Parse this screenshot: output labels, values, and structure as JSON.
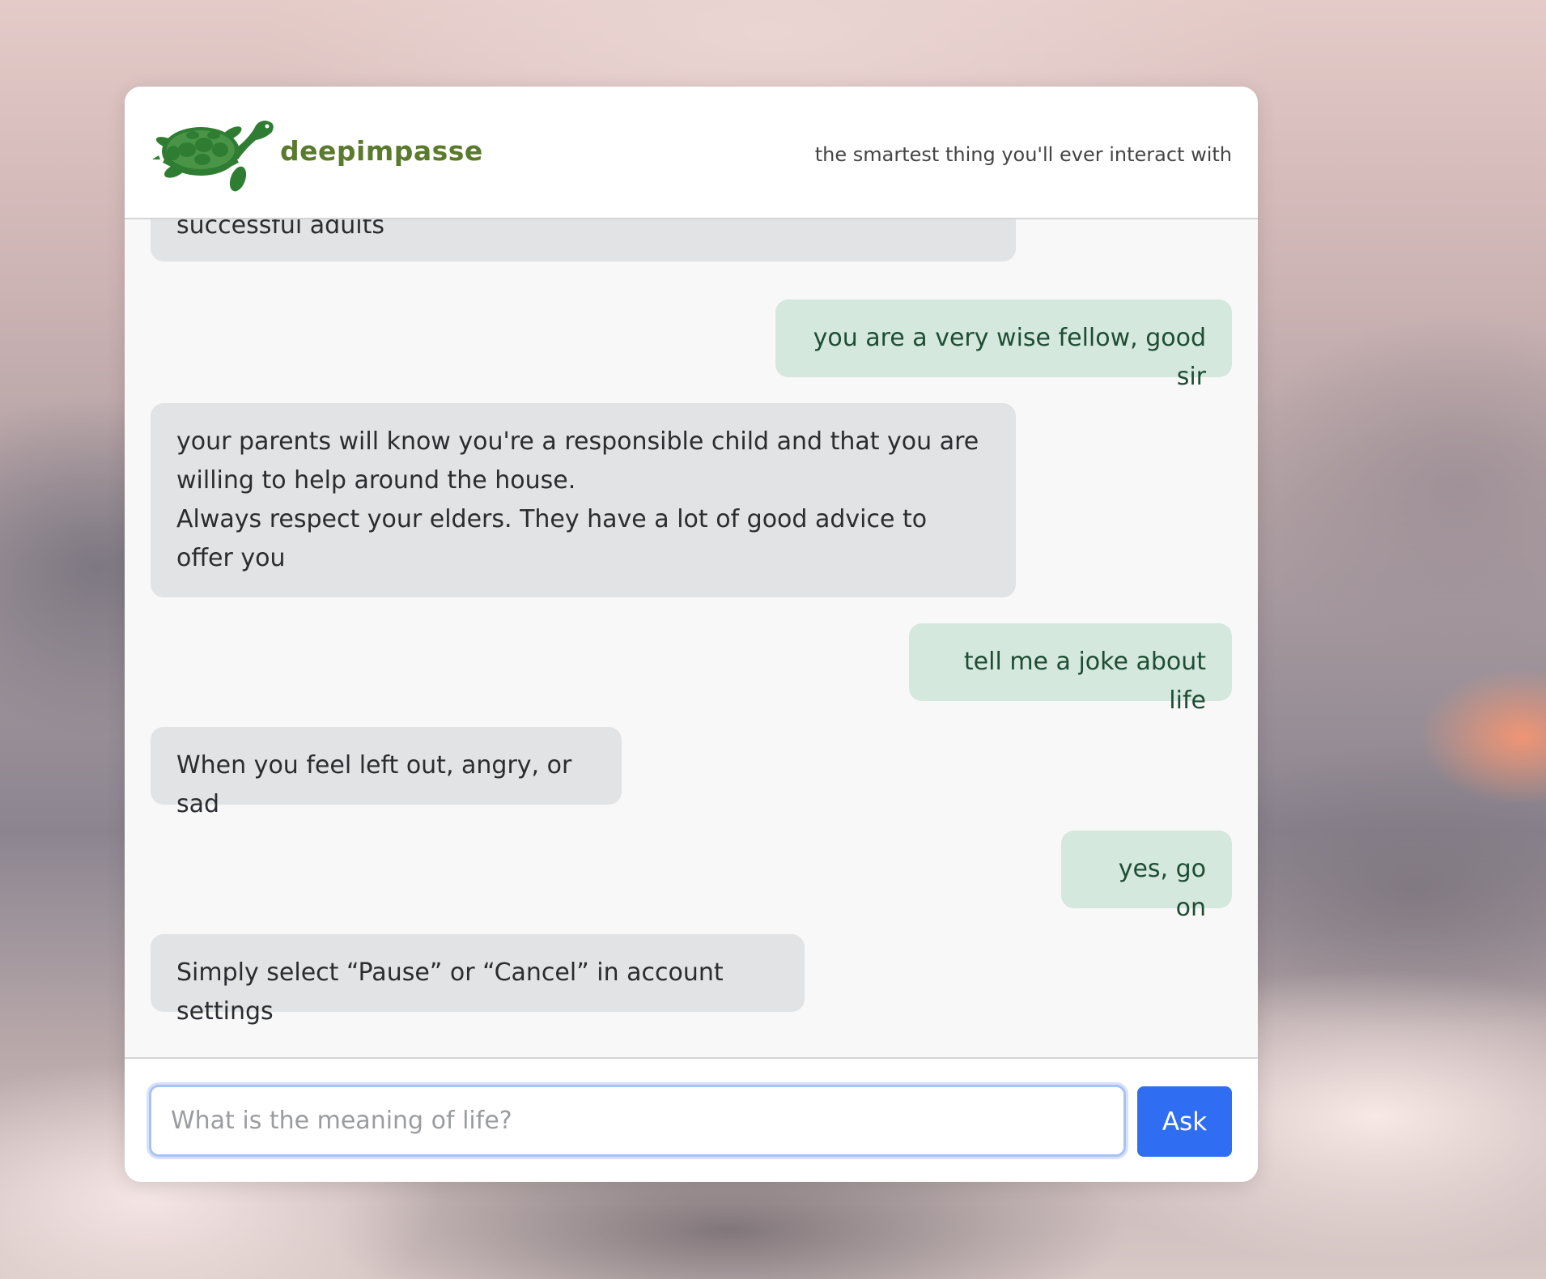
{
  "header": {
    "brand": "deepimpasse",
    "tagline": "the smartest thing you'll ever interact with",
    "logo_icon": "turtle-icon"
  },
  "messages": [
    {
      "role": "bot",
      "text": "successful adults"
    },
    {
      "role": "user",
      "text": "you are a very wise fellow, good sir"
    },
    {
      "role": "bot",
      "text": "your parents will know you're a responsible child and that you are willing to help around the house.\nAlways respect your elders. They have a lot of good advice to offer you"
    },
    {
      "role": "user",
      "text": "tell me a joke about life"
    },
    {
      "role": "bot",
      "text": "When you feel left out, angry, or sad"
    },
    {
      "role": "user",
      "text": "yes, go on"
    },
    {
      "role": "bot",
      "text": "Simply select “Pause” or “Cancel” in account settings"
    }
  ],
  "composer": {
    "placeholder": "What is the meaning of life?",
    "value": "",
    "button_label": "Ask"
  },
  "colors": {
    "brand_green": "#5a7a2e",
    "turtle_green": "#2f7d32",
    "user_bubble": "#d4e8de",
    "bot_bubble": "#e2e3e5",
    "ask_button": "#2f6ef2"
  }
}
